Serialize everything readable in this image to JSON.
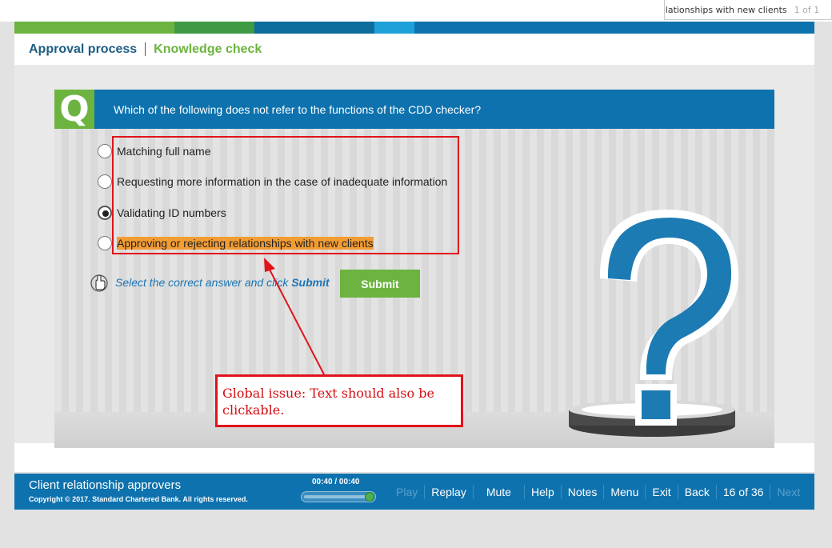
{
  "find_bar": {
    "text": "elationships with new clients",
    "count": "1 of 1"
  },
  "brand_strip_colors": [
    "#6cb33f",
    "#3e9a43",
    "#0c6d9c",
    "#1e5f8e",
    "#1ea1d8",
    "#0e72ae"
  ],
  "header": {
    "section": "Approval process",
    "module": "Knowledge check"
  },
  "question": {
    "badge": "Q",
    "text": "Which of the following does not refer to the functions of the CDD checker?",
    "options": [
      {
        "label": "Matching full name",
        "selected": false
      },
      {
        "label": "Requesting more information in the case of inadequate information",
        "selected": false
      },
      {
        "label": "Validating ID numbers",
        "selected": true
      },
      {
        "label": "Approving or rejecting relationships with new clients",
        "selected": false,
        "highlighted": true
      }
    ]
  },
  "instruction": {
    "prefix": "Select the correct answer and click ",
    "action": "Submit"
  },
  "submit_label": "Submit",
  "annotation": {
    "callout": "Global issue: Text should also be clickable."
  },
  "footer": {
    "course_title": "Client relationship approvers",
    "copyright": "Copyright © 2017. Standard Chartered Bank. All rights reserved.",
    "timer": "00:40 / 00:40",
    "progress": 1.0,
    "nav": {
      "play": "Play",
      "replay": "Replay",
      "mute": "Mute",
      "help": "Help",
      "notes": "Notes",
      "menu": "Menu",
      "exit": "Exit",
      "back": "Back",
      "page_counter": "16 of 36",
      "next": "Next"
    }
  },
  "icons": {
    "hand": "hand-pointer-icon",
    "question_mark": "question-mark-illustration"
  }
}
